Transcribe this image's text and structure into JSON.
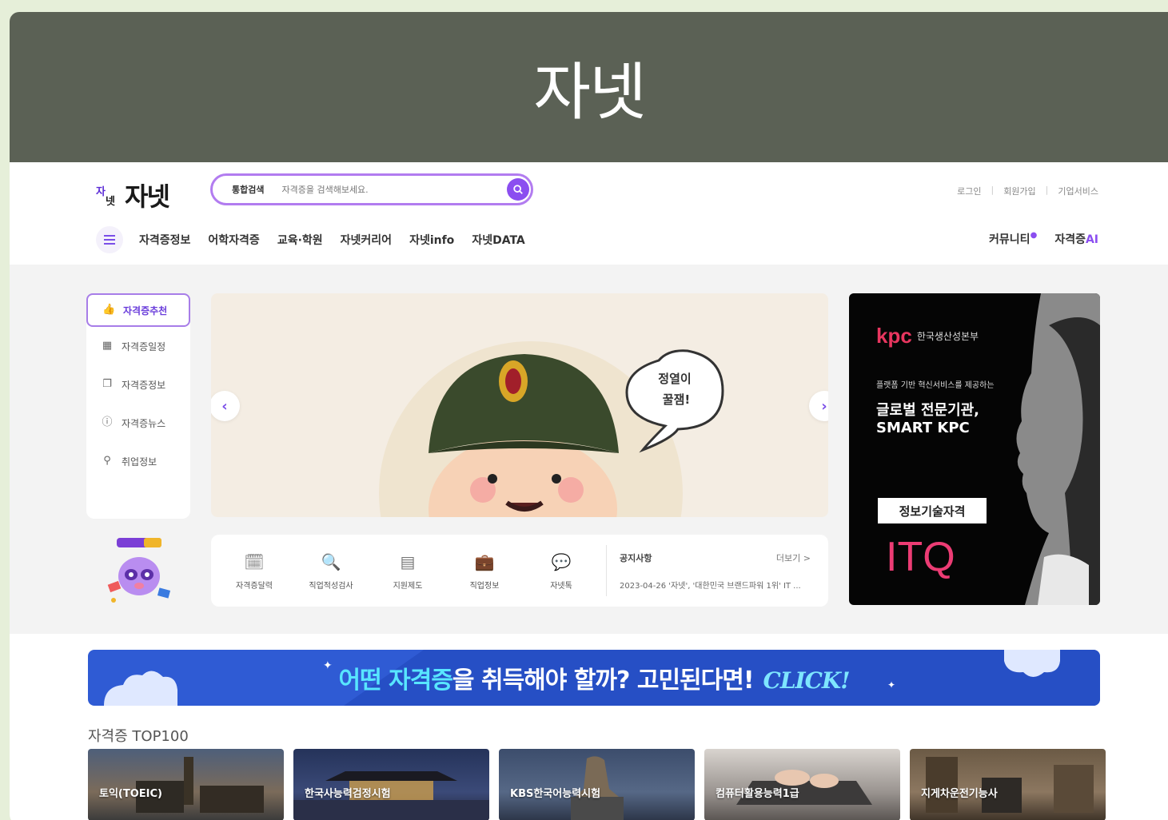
{
  "banner": {
    "title": "자넷"
  },
  "header": {
    "logo_mark_top": "자",
    "logo_mark_bottom": "넷",
    "logo_text": "자넷",
    "search": {
      "scope": "통합검색",
      "placeholder": "자격증을 검색해보세요."
    },
    "util": [
      "로그인",
      "회원가입",
      "기업서비스"
    ]
  },
  "gnb": {
    "items": [
      "자격증정보",
      "어학자격증",
      "교육·학원",
      "자넷커리어",
      "자넷info",
      "자넷DATA"
    ],
    "right": {
      "community": "커뮤니티",
      "ai_prefix": "자격증",
      "ai_suffix": "AI"
    }
  },
  "side_menu": {
    "items": [
      {
        "label": "자격증추천",
        "icon": "thumbs-up-icon",
        "glyph": "👍"
      },
      {
        "label": "자격증일정",
        "icon": "calendar-icon",
        "glyph": "▦"
      },
      {
        "label": "자격증정보",
        "icon": "document-icon",
        "glyph": "❐"
      },
      {
        "label": "자격증뉴스",
        "icon": "info-icon",
        "glyph": "ⓘ"
      },
      {
        "label": "취업정보",
        "icon": "location-pin-icon",
        "glyph": "⚲"
      }
    ]
  },
  "carousel": {
    "speech": [
      "정열이",
      "꿀잼!"
    ],
    "prev_glyph": "‹",
    "next_glyph": "›"
  },
  "quick_links": [
    {
      "label": "자격증달력",
      "icon": "calendar-icon",
      "glyph": "🗓"
    },
    {
      "label": "직업적성검사",
      "icon": "search-document-icon",
      "glyph": "🔍"
    },
    {
      "label": "지원제도",
      "icon": "screen-icon",
      "glyph": "▤"
    },
    {
      "label": "직업정보",
      "icon": "briefcase-icon",
      "glyph": "💼"
    },
    {
      "label": "자넷톡",
      "icon": "chat-icon",
      "glyph": "💬"
    }
  ],
  "notice": {
    "title": "공지사항",
    "more": "더보기 >",
    "line": "2023-04-26 '자넷', '대한민국 브랜드파워 1위' IT ..."
  },
  "ad": {
    "brand": "kpc",
    "org": "한국생산성본부",
    "tagline": "플랫폼 기반 혁신서비스를 제공하는",
    "headline_1": "글로벌 전문기관,",
    "headline_2": "SMART KPC",
    "pill": "정보기술자격",
    "big": "ITQ"
  },
  "cta": {
    "pre": "어떤 자격증",
    "post": "을 취득해야 할까? 고민된다면!",
    "click": "CLICK!"
  },
  "top100": {
    "title": "자격증 TOP100",
    "cards": [
      "토익(TOEIC)",
      "한국사능력검정시험",
      "KBS한국어능력시험",
      "컴퓨터활용능력1급",
      "지게차운전기능사"
    ]
  },
  "colors": {
    "banner_bg": "#5b6155",
    "accent": "#8b4ef0",
    "cta_bg": "#2f5bd4",
    "itq": "#ec3c74"
  }
}
